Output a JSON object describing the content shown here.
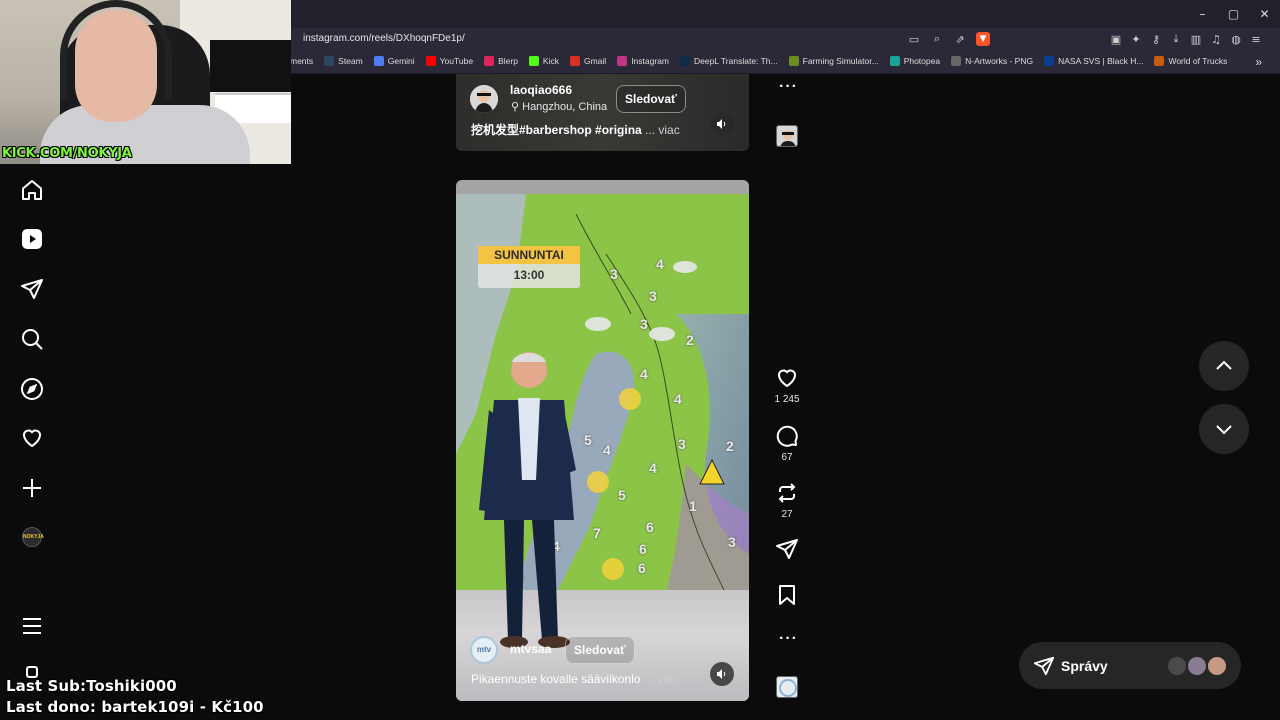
{
  "browser": {
    "url": "instagram.com/reels/DXhoqnFDe1p/",
    "window_controls": [
      "–",
      "▢",
      "✕"
    ],
    "bookmarks": [
      {
        "label": "ments",
        "icon": ""
      },
      {
        "label": "Steam",
        "icon": "steam-icon"
      },
      {
        "label": "Gemini",
        "icon": "gemini-icon"
      },
      {
        "label": "YouTube",
        "icon": "youtube-icon"
      },
      {
        "label": "Blerp",
        "icon": "blerp-icon"
      },
      {
        "label": "Kick",
        "icon": "kick-icon"
      },
      {
        "label": "Gmail",
        "icon": "gmail-icon"
      },
      {
        "label": "Instagram",
        "icon": "instagram-icon"
      },
      {
        "label": "DeepL Translate: Th...",
        "icon": "deepl-icon"
      },
      {
        "label": "Farming Simulator...",
        "icon": "farming-icon"
      },
      {
        "label": "Photopea",
        "icon": "photopea-icon"
      },
      {
        "label": "N-Artworks - PNG",
        "icon": "globe-icon"
      },
      {
        "label": "NASA SVS | Black H...",
        "icon": "nasa-icon"
      },
      {
        "label": "World of Trucks",
        "icon": "trucks-icon"
      }
    ],
    "bookmarks_more": "»"
  },
  "webcam": {
    "label": "KICK.COM/NOKYJA"
  },
  "sidebar": {
    "avatar_text": "NOKYJA"
  },
  "reel_top": {
    "username": "laoqiao666",
    "location": "Hangzhou, China",
    "follow_label": "Sledovať",
    "caption": "挖机发型#barbershop #origina",
    "caption_more": "... viac"
  },
  "reel_main": {
    "map_day": "SUNNUNTAI",
    "map_time": "13:00",
    "map_numbers": [
      "3",
      "4",
      "3",
      "3",
      "2",
      "4",
      "4",
      "5",
      "4",
      "3",
      "2",
      "4",
      "5",
      "7",
      "6",
      "6",
      "4",
      "6",
      "3",
      "1",
      "5",
      "3",
      "3"
    ],
    "username": "mtvsaa",
    "avatar_text": "mtv",
    "follow_label": "Sledovať",
    "caption": "Pikaennuste kovalle sääviikonlo",
    "caption_more": "... viac"
  },
  "actions": {
    "likes": "1 245",
    "comments": "67",
    "reposts": "27"
  },
  "messages": {
    "label": "Správy"
  },
  "stream_overlay": {
    "last_sub": "Last Sub:Toshiki000",
    "last_dono": "Last dono: bartek109i - Kč100"
  },
  "colors": {
    "background": "#0b0b0b",
    "chrome": "#2b2937",
    "overlay_green": "#7cf53b",
    "map_label": "#f3c343"
  }
}
